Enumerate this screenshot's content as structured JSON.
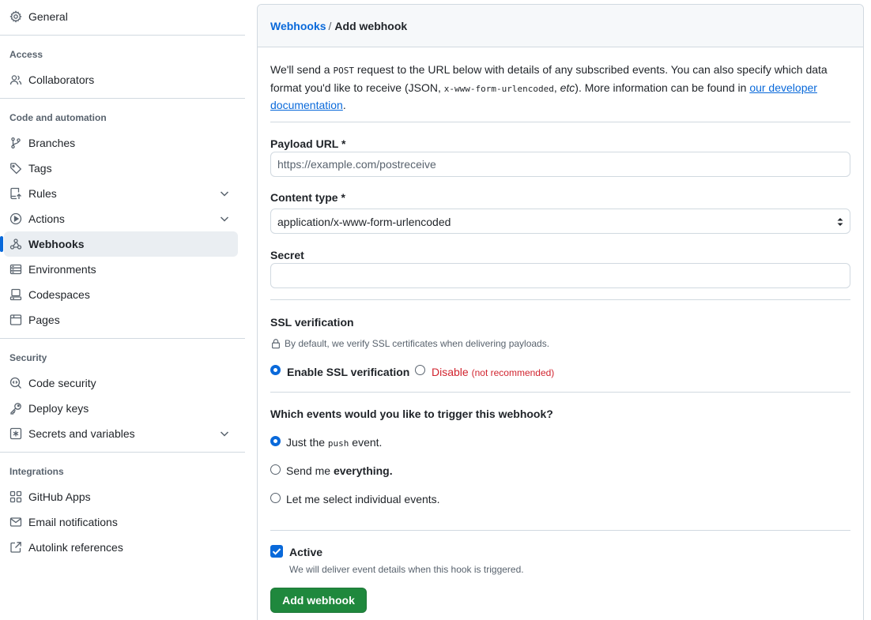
{
  "sidebar": {
    "general": "General",
    "groups": {
      "access": "Access",
      "code_automation": "Code and automation",
      "security": "Security",
      "integrations": "Integrations"
    },
    "items": {
      "collaborators": "Collaborators",
      "branches": "Branches",
      "tags": "Tags",
      "rules": "Rules",
      "actions": "Actions",
      "webhooks": "Webhooks",
      "environments": "Environments",
      "codespaces": "Codespaces",
      "pages": "Pages",
      "code_security": "Code security",
      "deploy_keys": "Deploy keys",
      "secrets_variables": "Secrets and variables",
      "github_apps": "GitHub Apps",
      "email_notifications": "Email notifications",
      "autolink_references": "Autolink references"
    },
    "active_item": "Webhooks"
  },
  "breadcrumb": {
    "parent": "Webhooks",
    "separator": "/",
    "current": "Add webhook"
  },
  "intro": {
    "part1": "We'll send a ",
    "method": "POST",
    "part2": " request to the URL below with details of any subscribed events. You can also specify which data format you'd like to receive (JSON, ",
    "format_code": "x-www-form-urlencoded",
    "part3": ", ",
    "etc": "etc",
    "part4": "). More information can be found in ",
    "link": "our developer documentation",
    "part5": "."
  },
  "form": {
    "payload_url": {
      "label": "Payload URL *",
      "placeholder": "https://example.com/postreceive",
      "value": ""
    },
    "content_type": {
      "label": "Content type *",
      "value": "application/x-www-form-urlencoded"
    },
    "secret": {
      "label": "Secret",
      "value": ""
    },
    "ssl": {
      "title": "SSL verification",
      "help": "By default, we verify SSL certificates when delivering payloads.",
      "enable_label": "Enable SSL verification",
      "disable_label": "Disable",
      "disable_note": "(not recommended)",
      "selected": "enable"
    },
    "events": {
      "title": "Which events would you like to trigger this webhook?",
      "option1_pre": "Just the ",
      "option1_code": "push",
      "option1_post": " event.",
      "option2_pre": "Send me ",
      "option2_bold": "everything.",
      "option3": "Let me select individual events.",
      "selected": "push"
    },
    "active": {
      "label": "Active",
      "help": "We will deliver event details when this hook is triggered.",
      "checked": true
    },
    "submit_label": "Add webhook"
  },
  "colors": {
    "accent": "#0969da",
    "primary_button": "#1f883d",
    "danger": "#d1242f"
  }
}
